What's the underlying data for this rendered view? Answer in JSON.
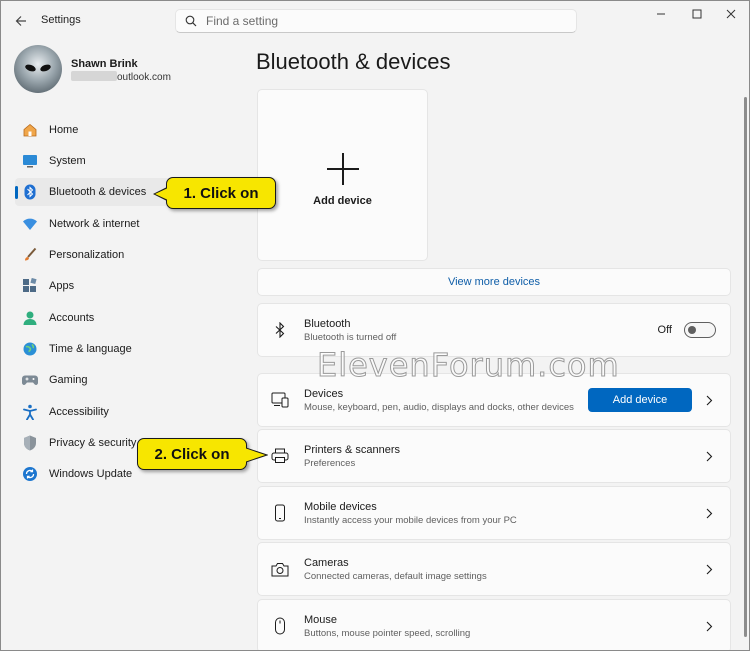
{
  "window": {
    "title": "Settings",
    "search_placeholder": "Find a setting",
    "controls": [
      "minimize-icon",
      "maximize-icon",
      "close-icon"
    ]
  },
  "profile": {
    "name": "Shawn Brink",
    "email_suffix": "outlook.com"
  },
  "sidebar": {
    "items": [
      {
        "label": "Home",
        "icon": "home-icon",
        "selected": false
      },
      {
        "label": "System",
        "icon": "system-icon",
        "selected": false
      },
      {
        "label": "Bluetooth & devices",
        "icon": "bluetooth-icon",
        "selected": true
      },
      {
        "label": "Network & internet",
        "icon": "wifi-icon",
        "selected": false
      },
      {
        "label": "Personalization",
        "icon": "brush-icon",
        "selected": false
      },
      {
        "label": "Apps",
        "icon": "apps-icon",
        "selected": false
      },
      {
        "label": "Accounts",
        "icon": "accounts-icon",
        "selected": false
      },
      {
        "label": "Time & language",
        "icon": "globe-icon",
        "selected": false
      },
      {
        "label": "Gaming",
        "icon": "gamepad-icon",
        "selected": false
      },
      {
        "label": "Accessibility",
        "icon": "accessibility-icon",
        "selected": false
      },
      {
        "label": "Privacy & security",
        "icon": "shield-icon",
        "selected": false
      },
      {
        "label": "Windows Update",
        "icon": "update-icon",
        "selected": false
      }
    ]
  },
  "main": {
    "title": "Bluetooth & devices",
    "add_device_tile": "Add device",
    "view_more": "View more devices",
    "bluetooth": {
      "title": "Bluetooth",
      "subtitle": "Bluetooth is turned off",
      "state": "Off"
    },
    "rows": [
      {
        "title": "Devices",
        "subtitle": "Mouse, keyboard, pen, audio, displays and docks, other devices",
        "icon": "devices-icon",
        "button": "Add device"
      },
      {
        "title": "Printers & scanners",
        "subtitle": "Preferences",
        "icon": "printer-icon"
      },
      {
        "title": "Mobile devices",
        "subtitle": "Instantly access your mobile devices from your PC",
        "icon": "phone-icon"
      },
      {
        "title": "Cameras",
        "subtitle": "Connected cameras, default image settings",
        "icon": "camera-icon"
      },
      {
        "title": "Mouse",
        "subtitle": "Buttons, mouse pointer speed, scrolling",
        "icon": "mouse-icon"
      }
    ]
  },
  "annotations": {
    "step1": "1. Click on",
    "step2": "2. Click on",
    "watermark": "ElevenForum.com"
  },
  "colors": {
    "accent": "#0067c0",
    "callout": "#f7e600",
    "window_bg": "#f3f3f3",
    "card_bg": "#fbfbfb"
  }
}
